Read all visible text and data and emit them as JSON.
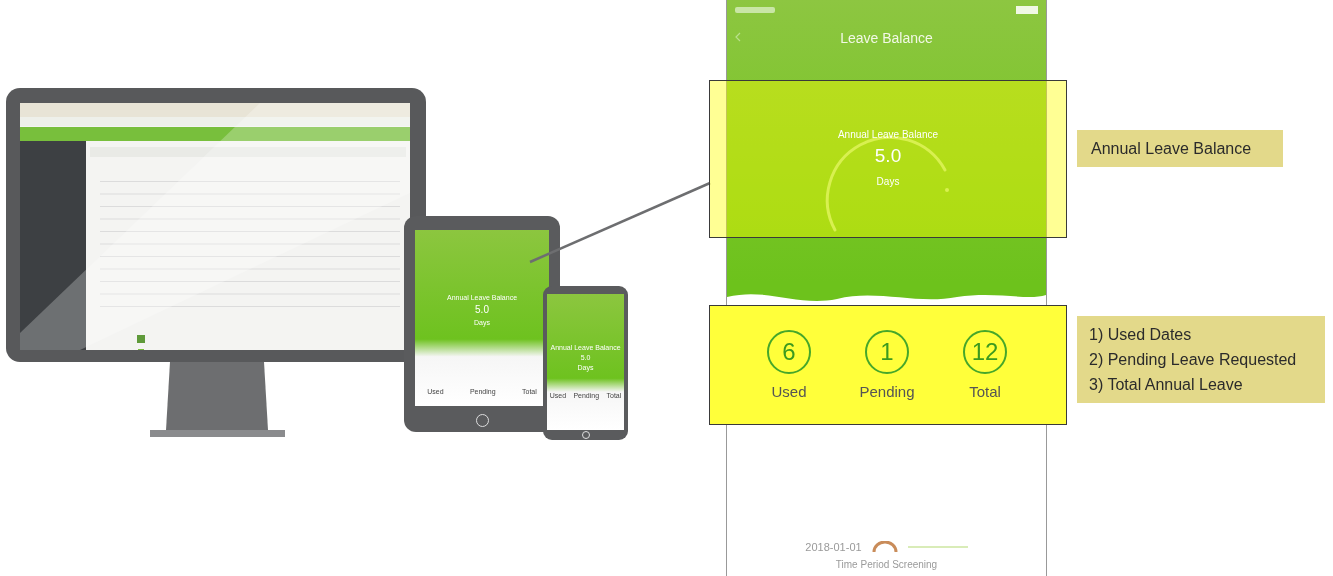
{
  "tablet": {
    "balance_label": "Annual Leave Balance",
    "balance_value": "5.0",
    "balance_unit": "Days",
    "stats": [
      {
        "label": "Used"
      },
      {
        "label": "Pending"
      },
      {
        "label": "Total"
      }
    ]
  },
  "phone": {
    "balance_label": "Annual Leave Balance",
    "balance_value": "5.0",
    "balance_unit": "Days",
    "stats": [
      {
        "label": "Used"
      },
      {
        "label": "Pending"
      },
      {
        "label": "Total"
      }
    ]
  },
  "detail": {
    "title": "Leave Balance",
    "balance_label": "Annual Leave Balance",
    "balance_value": "5.0",
    "balance_unit": "Days",
    "stats": [
      {
        "value": "6",
        "label": "Used"
      },
      {
        "value": "1",
        "label": "Pending"
      },
      {
        "value": "12",
        "label": "Total"
      }
    ],
    "footer": {
      "date": "2018-01-01",
      "caption": "Time Period Screening"
    }
  },
  "callouts": [
    {
      "lines": [
        "Annual Leave Balance"
      ]
    },
    {
      "lines": [
        "1) Used Dates",
        "2) Pending Leave Requested",
        "3) Total Annual Leave"
      ]
    }
  ]
}
